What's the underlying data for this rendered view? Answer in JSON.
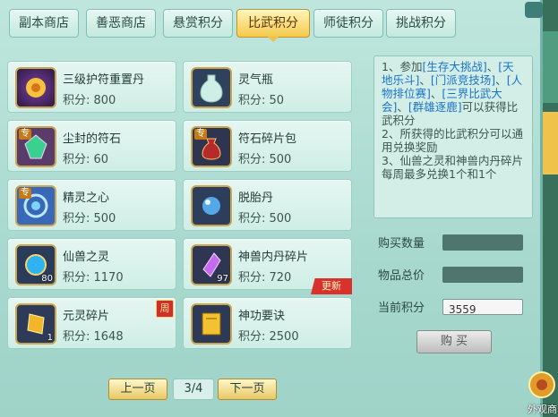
{
  "tabs": [
    {
      "label": "副本商店"
    },
    {
      "label": "善恶商店"
    },
    {
      "label": "悬赏积分"
    },
    {
      "label": "比武积分"
    },
    {
      "label": "师徒积分"
    },
    {
      "label": "挑战积分"
    }
  ],
  "items": [
    {
      "name": "三级护符重置丹",
      "price": "积分: 800",
      "icon": "lotus-icon",
      "count": "",
      "special": "",
      "badge": ""
    },
    {
      "name": "灵气瓶",
      "price": "积分: 50",
      "icon": "vase-icon",
      "count": "",
      "special": "",
      "badge": ""
    },
    {
      "name": "尘封的符石",
      "price": "积分: 60",
      "icon": "gem-icon",
      "count": "",
      "special": "专",
      "badge": ""
    },
    {
      "name": "符石碎片包",
      "price": "积分: 500",
      "icon": "bag-icon",
      "count": "",
      "special": "专",
      "badge": ""
    },
    {
      "name": "精灵之心",
      "price": "积分: 500",
      "icon": "spirit-heart-icon",
      "count": "",
      "special": "专",
      "badge": ""
    },
    {
      "name": "脱胎丹",
      "price": "积分: 500",
      "icon": "pill-icon",
      "count": "",
      "special": "",
      "badge": ""
    },
    {
      "name": "仙兽之灵",
      "price": "积分: 1170",
      "icon": "orb-icon",
      "count": "80",
      "special": "",
      "badge": ""
    },
    {
      "name": "神兽内丹碎片",
      "price": "积分: 720",
      "icon": "crystal-icon",
      "count": "97",
      "special": "",
      "badge": "更新"
    },
    {
      "name": "元灵碎片",
      "price": "积分: 1648",
      "icon": "amber-shard-icon",
      "count": "1",
      "special": "",
      "badge": "周"
    },
    {
      "name": "神功要诀",
      "price": "积分: 2500",
      "icon": "book-icon",
      "count": "",
      "special": "",
      "badge": ""
    }
  ],
  "info": {
    "p1_prefix": "1、参加",
    "p1_links": [
      "[生存大挑战]",
      "[天地乐斗]",
      "[门派竞技场]",
      "[人物排位赛]",
      "[三界比武大会]",
      "[群雄逐鹿]"
    ],
    "p1_suffix": "可以获得比武积分",
    "p2": "2、所获得的比武积分可以通用兑换奖励",
    "p3": "3、仙兽之灵和神兽内丹碎片每周最多兑换1个和1个"
  },
  "form": {
    "qty_label": "购买数量",
    "total_label": "物品总价",
    "current_label": "当前积分",
    "current_value": "3559",
    "buy_label": "购 买"
  },
  "pager": {
    "prev": "上一页",
    "page": "3/4",
    "next": "下一页"
  },
  "side": {
    "bottom_label": "外观商"
  }
}
